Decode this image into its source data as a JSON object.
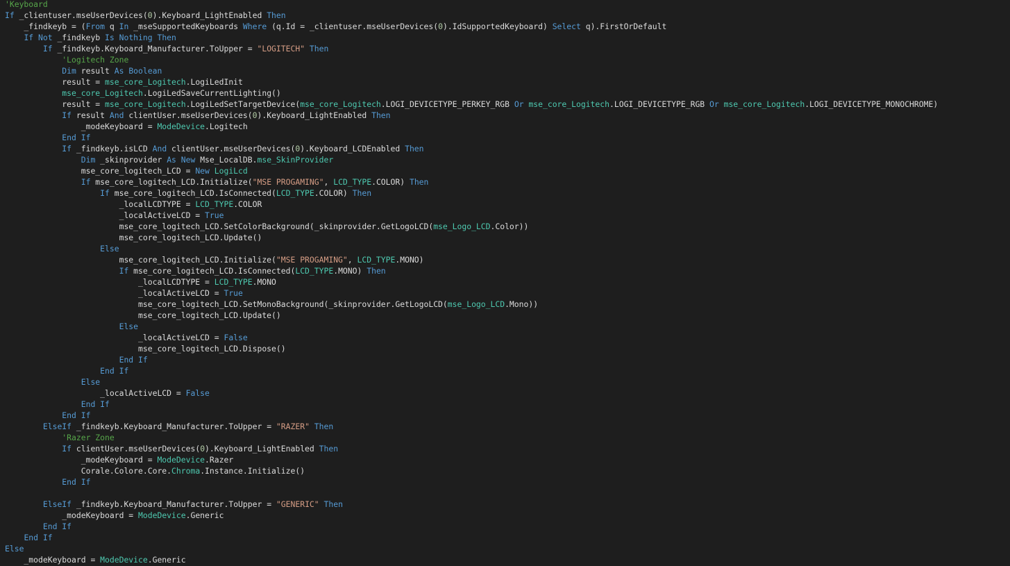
{
  "colors": {
    "background": "#1e1e1e",
    "text": "#dcdcdc",
    "keyword": "#569cd6",
    "comment": "#57a64a",
    "type": "#4ec9b0",
    "string": "#d69d85",
    "number": "#b5cea8"
  },
  "code": {
    "lines": [
      [
        [
          "cm",
          "'Keyboard"
        ]
      ],
      [
        [
          "kw",
          "If"
        ],
        [
          "tx",
          " _clientuser.mseUserDevices("
        ],
        [
          "nm",
          "0"
        ],
        [
          "tx",
          ").Keyboard_LightEnabled "
        ],
        [
          "kw",
          "Then"
        ]
      ],
      [
        [
          "tx",
          "    _findkeyb = ("
        ],
        [
          "kw",
          "From"
        ],
        [
          "tx",
          " q "
        ],
        [
          "kw",
          "In"
        ],
        [
          "tx",
          " _mseSupportedKeyboards "
        ],
        [
          "kw",
          "Where"
        ],
        [
          "tx",
          " (q.Id = _clientuser.mseUserDevices("
        ],
        [
          "nm",
          "0"
        ],
        [
          "tx",
          ").IdSupportedKeyboard) "
        ],
        [
          "kw",
          "Select"
        ],
        [
          "tx",
          " q).FirstOrDefault"
        ]
      ],
      [
        [
          "tx",
          "    "
        ],
        [
          "kw",
          "If Not"
        ],
        [
          "tx",
          " _findkeyb "
        ],
        [
          "kw",
          "Is Nothing Then"
        ]
      ],
      [
        [
          "tx",
          "        "
        ],
        [
          "kw",
          "If"
        ],
        [
          "tx",
          " _findkeyb.Keyboard_Manufacturer.ToUpper = "
        ],
        [
          "st",
          "\"LOGITECH\""
        ],
        [
          "tx",
          " "
        ],
        [
          "kw",
          "Then"
        ]
      ],
      [
        [
          "tx",
          "            "
        ],
        [
          "cm",
          "'Logitech Zone"
        ]
      ],
      [
        [
          "tx",
          "            "
        ],
        [
          "kw",
          "Dim"
        ],
        [
          "tx",
          " result "
        ],
        [
          "kw",
          "As Boolean"
        ]
      ],
      [
        [
          "tx",
          "            result = "
        ],
        [
          "ty",
          "mse_core_Logitech"
        ],
        [
          "tx",
          ".LogiLedInit"
        ]
      ],
      [
        [
          "tx",
          "            "
        ],
        [
          "ty",
          "mse_core_Logitech"
        ],
        [
          "tx",
          ".LogiLedSaveCurrentLighting()"
        ]
      ],
      [
        [
          "tx",
          "            result = "
        ],
        [
          "ty",
          "mse_core_Logitech"
        ],
        [
          "tx",
          ".LogiLedSetTargetDevice("
        ],
        [
          "ty",
          "mse_core_Logitech"
        ],
        [
          "tx",
          ".LOGI_DEVICETYPE_PERKEY_RGB "
        ],
        [
          "kw",
          "Or"
        ],
        [
          "tx",
          " "
        ],
        [
          "ty",
          "mse_core_Logitech"
        ],
        [
          "tx",
          ".LOGI_DEVICETYPE_RGB "
        ],
        [
          "kw",
          "Or"
        ],
        [
          "tx",
          " "
        ],
        [
          "ty",
          "mse_core_Logitech"
        ],
        [
          "tx",
          ".LOGI_DEVICETYPE_MONOCHROME)"
        ]
      ],
      [
        [
          "tx",
          "            "
        ],
        [
          "kw",
          "If"
        ],
        [
          "tx",
          " result "
        ],
        [
          "kw",
          "And"
        ],
        [
          "tx",
          " clientUser.mseUserDevices("
        ],
        [
          "nm",
          "0"
        ],
        [
          "tx",
          ").Keyboard_LightEnabled "
        ],
        [
          "kw",
          "Then"
        ]
      ],
      [
        [
          "tx",
          "                _modeKeyboard = "
        ],
        [
          "ty",
          "ModeDevice"
        ],
        [
          "tx",
          ".Logitech"
        ]
      ],
      [
        [
          "tx",
          "            "
        ],
        [
          "kw",
          "End If"
        ]
      ],
      [
        [
          "tx",
          "            "
        ],
        [
          "kw",
          "If"
        ],
        [
          "tx",
          " _findkeyb.isLCD "
        ],
        [
          "kw",
          "And"
        ],
        [
          "tx",
          " clientUser.mseUserDevices("
        ],
        [
          "nm",
          "0"
        ],
        [
          "tx",
          ").Keyboard_LCDEnabled "
        ],
        [
          "kw",
          "Then"
        ]
      ],
      [
        [
          "tx",
          "                "
        ],
        [
          "kw",
          "Dim"
        ],
        [
          "tx",
          " _skinprovider "
        ],
        [
          "kw",
          "As New"
        ],
        [
          "tx",
          " Mse_LocalDB."
        ],
        [
          "ty",
          "mse_SkinProvider"
        ]
      ],
      [
        [
          "tx",
          "                mse_core_logitech_LCD = "
        ],
        [
          "kw",
          "New"
        ],
        [
          "tx",
          " "
        ],
        [
          "ty",
          "LogiLcd"
        ]
      ],
      [
        [
          "tx",
          "                "
        ],
        [
          "kw",
          "If"
        ],
        [
          "tx",
          " mse_core_logitech_LCD.Initialize("
        ],
        [
          "st",
          "\"MSE PROGAMING\""
        ],
        [
          "tx",
          ", "
        ],
        [
          "ty",
          "LCD_TYPE"
        ],
        [
          "tx",
          ".COLOR) "
        ],
        [
          "kw",
          "Then"
        ]
      ],
      [
        [
          "tx",
          "                    "
        ],
        [
          "kw",
          "If"
        ],
        [
          "tx",
          " mse_core_logitech_LCD.IsConnected("
        ],
        [
          "ty",
          "LCD_TYPE"
        ],
        [
          "tx",
          ".COLOR) "
        ],
        [
          "kw",
          "Then"
        ]
      ],
      [
        [
          "tx",
          "                        _localLCDTYPE = "
        ],
        [
          "ty",
          "LCD_TYPE"
        ],
        [
          "tx",
          ".COLOR"
        ]
      ],
      [
        [
          "tx",
          "                        _localActiveLCD = "
        ],
        [
          "kw",
          "True"
        ]
      ],
      [
        [
          "tx",
          "                        mse_core_logitech_LCD.SetColorBackground(_skinprovider.GetLogoLCD("
        ],
        [
          "ty",
          "mse_Logo_LCD"
        ],
        [
          "tx",
          ".Color))"
        ]
      ],
      [
        [
          "tx",
          "                        mse_core_logitech_LCD.Update()"
        ]
      ],
      [
        [
          "tx",
          "                    "
        ],
        [
          "kw",
          "Else"
        ]
      ],
      [
        [
          "tx",
          "                        mse_core_logitech_LCD.Initialize("
        ],
        [
          "st",
          "\"MSE PROGAMING\""
        ],
        [
          "tx",
          ", "
        ],
        [
          "ty",
          "LCD_TYPE"
        ],
        [
          "tx",
          ".MONO)"
        ]
      ],
      [
        [
          "tx",
          "                        "
        ],
        [
          "kw",
          "If"
        ],
        [
          "tx",
          " mse_core_logitech_LCD.IsConnected("
        ],
        [
          "ty",
          "LCD_TYPE"
        ],
        [
          "tx",
          ".MONO) "
        ],
        [
          "kw",
          "Then"
        ]
      ],
      [
        [
          "tx",
          "                            _localLCDTYPE = "
        ],
        [
          "ty",
          "LCD_TYPE"
        ],
        [
          "tx",
          ".MONO"
        ]
      ],
      [
        [
          "tx",
          "                            _localActiveLCD = "
        ],
        [
          "kw",
          "True"
        ]
      ],
      [
        [
          "tx",
          "                            mse_core_logitech_LCD.SetMonoBackground(_skinprovider.GetLogoLCD("
        ],
        [
          "ty",
          "mse_Logo_LCD"
        ],
        [
          "tx",
          ".Mono))"
        ]
      ],
      [
        [
          "tx",
          "                            mse_core_logitech_LCD.Update()"
        ]
      ],
      [
        [
          "tx",
          "                        "
        ],
        [
          "kw",
          "Else"
        ]
      ],
      [
        [
          "tx",
          "                            _localActiveLCD = "
        ],
        [
          "kw",
          "False"
        ]
      ],
      [
        [
          "tx",
          "                            mse_core_logitech_LCD.Dispose()"
        ]
      ],
      [
        [
          "tx",
          "                        "
        ],
        [
          "kw",
          "End If"
        ]
      ],
      [
        [
          "tx",
          "                    "
        ],
        [
          "kw",
          "End If"
        ]
      ],
      [
        [
          "tx",
          "                "
        ],
        [
          "kw",
          "Else"
        ]
      ],
      [
        [
          "tx",
          "                    _localActiveLCD = "
        ],
        [
          "kw",
          "False"
        ]
      ],
      [
        [
          "tx",
          "                "
        ],
        [
          "kw",
          "End If"
        ]
      ],
      [
        [
          "tx",
          "            "
        ],
        [
          "kw",
          "End If"
        ]
      ],
      [
        [
          "tx",
          "        "
        ],
        [
          "kw",
          "ElseIf"
        ],
        [
          "tx",
          " _findkeyb.Keyboard_Manufacturer.ToUpper = "
        ],
        [
          "st",
          "\"RAZER\""
        ],
        [
          "tx",
          " "
        ],
        [
          "kw",
          "Then"
        ]
      ],
      [
        [
          "tx",
          "            "
        ],
        [
          "cm",
          "'Razer Zone"
        ]
      ],
      [
        [
          "tx",
          "            "
        ],
        [
          "kw",
          "If"
        ],
        [
          "tx",
          " clientUser.mseUserDevices("
        ],
        [
          "nm",
          "0"
        ],
        [
          "tx",
          ").Keyboard_LightEnabled "
        ],
        [
          "kw",
          "Then"
        ]
      ],
      [
        [
          "tx",
          "                _modeKeyboard = "
        ],
        [
          "ty",
          "ModeDevice"
        ],
        [
          "tx",
          ".Razer"
        ]
      ],
      [
        [
          "tx",
          "                Corale.Colore.Core."
        ],
        [
          "ty",
          "Chroma"
        ],
        [
          "tx",
          ".Instance.Initialize()"
        ]
      ],
      [
        [
          "tx",
          "            "
        ],
        [
          "kw",
          "End If"
        ]
      ],
      [
        [
          "tx",
          ""
        ]
      ],
      [
        [
          "tx",
          "        "
        ],
        [
          "kw",
          "ElseIf"
        ],
        [
          "tx",
          " _findkeyb.Keyboard_Manufacturer.ToUpper = "
        ],
        [
          "st",
          "\"GENERIC\""
        ],
        [
          "tx",
          " "
        ],
        [
          "kw",
          "Then"
        ]
      ],
      [
        [
          "tx",
          "            _modeKeyboard = "
        ],
        [
          "ty",
          "ModeDevice"
        ],
        [
          "tx",
          ".Generic"
        ]
      ],
      [
        [
          "tx",
          "        "
        ],
        [
          "kw",
          "End If"
        ]
      ],
      [
        [
          "tx",
          "    "
        ],
        [
          "kw",
          "End If"
        ]
      ],
      [
        [
          "kw",
          "Else"
        ]
      ],
      [
        [
          "tx",
          "    _modeKeyboard = "
        ],
        [
          "ty",
          "ModeDevice"
        ],
        [
          "tx",
          ".Generic"
        ]
      ]
    ]
  }
}
